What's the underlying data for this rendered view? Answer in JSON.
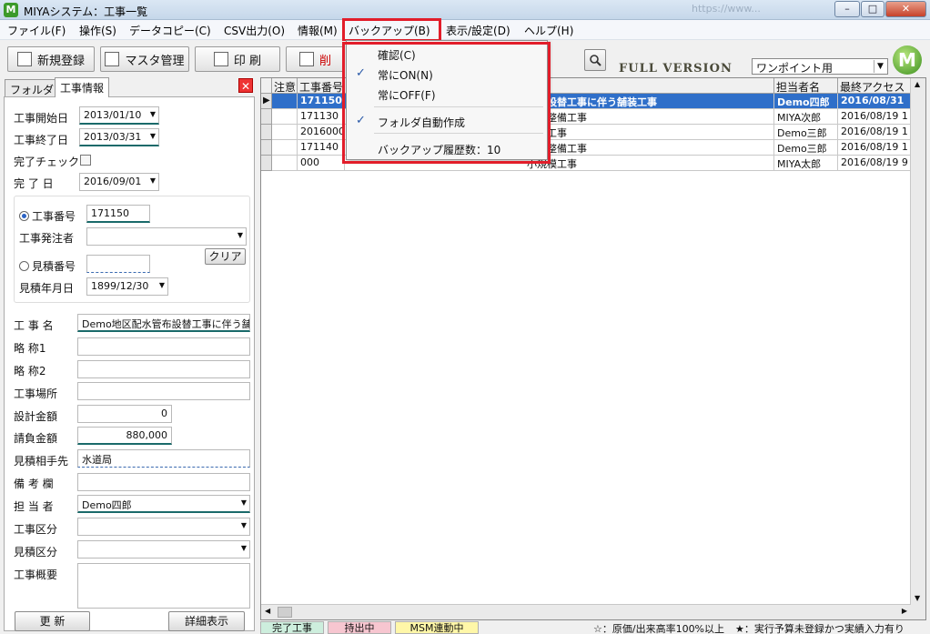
{
  "window": {
    "title": "MIYAシステム：工事一覧",
    "blur_url": "https://www...",
    "buttons": {
      "minimize": "–",
      "maximize": "□",
      "close": "✕"
    }
  },
  "menubar": {
    "items": [
      "ファイル(F)",
      "操作(S)",
      "データコピー(C)",
      "CSV出力(O)",
      "情報(M)",
      "バックアップ(B)",
      "表示/設定(D)",
      "ヘルプ(H)"
    ]
  },
  "toolbar": {
    "new_label": "新規登録",
    "master_label": "マスタ管理",
    "print_label": "印 刷",
    "delete_label": "削",
    "edition": "FULL VERSION",
    "onepoint_value": "ワンポイント用",
    "logo": "M"
  },
  "backup_menu": {
    "items": [
      {
        "label": "確認(C)",
        "checked": false
      },
      {
        "label": "常にON(N)",
        "checked": true
      },
      {
        "label": "常にOFF(F)",
        "checked": false
      },
      {
        "label": "フォルダ自動作成",
        "checked": true
      },
      {
        "label": "バックアップ履歴数：10",
        "checked": false
      }
    ]
  },
  "left": {
    "tabs": [
      "フォルダ",
      "工事情報"
    ],
    "start_label": "工事開始日",
    "start_value": "2013/01/10",
    "end_label": "工事終了日",
    "end_value": "2013/03/31",
    "complete_check_label": "完了チェック",
    "complete_date_label": "完 了 日",
    "complete_date_value": "2016/09/01",
    "work_no_label": "工事番号",
    "work_no_value": "171150",
    "client_label": "工事発注者",
    "client_value": "",
    "clear_label": "クリア",
    "estimate_no_label": "見積番号",
    "estimate_no_value": "",
    "estimate_date_label": "見積年月日",
    "estimate_date_value": "1899/12/30",
    "name_label": "工 事 名",
    "name_value": "Demo地区配水管布設替工事に伴う舗",
    "abbr1_label": "略 称1",
    "abbr1_value": "",
    "abbr2_label": "略 称2",
    "abbr2_value": "",
    "place_label": "工事場所",
    "place_value": "",
    "design_amount_label": "設計金額",
    "design_amount_value": "0",
    "contract_amount_label": "請負金額",
    "contract_amount_value": "880,000",
    "estimate_partner_label": "見積相手先",
    "estimate_partner_value": "水道局",
    "remarks_label": "備 考 欄",
    "remarks_value": "",
    "person_label": "担 当 者",
    "person_value": "Demo四郎",
    "work_type_label": "工事区分",
    "work_type_value": "",
    "estimate_type_label": "見積区分",
    "estimate_type_value": "",
    "summary_label": "工事概要",
    "summary_value": "",
    "update_label": "更 新",
    "detail_label": "詳細表示"
  },
  "grid": {
    "columns": [
      "注意",
      "工事番号",
      "設替工事に伴う舗装工事",
      "担当者名",
      "最終アクセス"
    ],
    "rows": [
      {
        "note": "",
        "no": "171150",
        "name": "設替工事に伴う舗装工事",
        "person": "Demo四郎",
        "date": "2016/08/31"
      },
      {
        "note": "",
        "no": "171130",
        "name": "整備工事",
        "person": "MIYA次郎",
        "date": "2016/08/19 1"
      },
      {
        "note": "",
        "no": "20160001",
        "name": "工事",
        "person": "Demo三郎",
        "date": "2016/08/19 1"
      },
      {
        "note": "",
        "no": "171140",
        "name": "整備工事",
        "person": "Demo三郎",
        "date": "2016/08/19 1"
      },
      {
        "note": "",
        "no": "000",
        "name": "小規模工事",
        "person": "MIYA太郎",
        "date": "2016/08/19 9"
      }
    ]
  },
  "statusbar": {
    "done": "完了工事",
    "out": "持出中",
    "msm": "MSM連動中",
    "note1": "☆：原価/出来高率100%以上",
    "note2": "★：実行予算未登録かつ実績入力有り"
  }
}
